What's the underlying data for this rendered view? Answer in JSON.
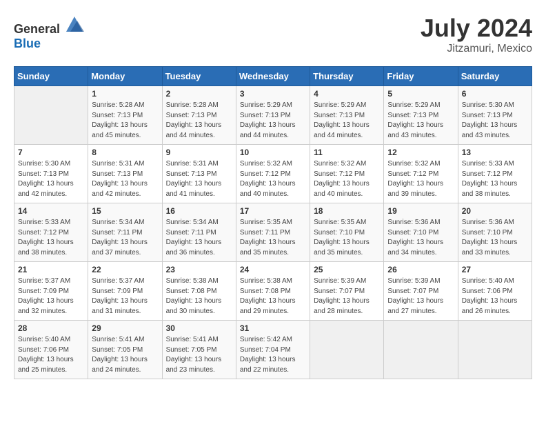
{
  "header": {
    "logo_general": "General",
    "logo_blue": "Blue",
    "month_year": "July 2024",
    "location": "Jitzamuri, Mexico"
  },
  "days_of_week": [
    "Sunday",
    "Monday",
    "Tuesday",
    "Wednesday",
    "Thursday",
    "Friday",
    "Saturday"
  ],
  "weeks": [
    [
      {
        "day": "",
        "sunrise": "",
        "sunset": "",
        "daylight": "",
        "empty": true
      },
      {
        "day": "1",
        "sunrise": "Sunrise: 5:28 AM",
        "sunset": "Sunset: 7:13 PM",
        "daylight": "Daylight: 13 hours and 45 minutes.",
        "empty": false
      },
      {
        "day": "2",
        "sunrise": "Sunrise: 5:28 AM",
        "sunset": "Sunset: 7:13 PM",
        "daylight": "Daylight: 13 hours and 44 minutes.",
        "empty": false
      },
      {
        "day": "3",
        "sunrise": "Sunrise: 5:29 AM",
        "sunset": "Sunset: 7:13 PM",
        "daylight": "Daylight: 13 hours and 44 minutes.",
        "empty": false
      },
      {
        "day": "4",
        "sunrise": "Sunrise: 5:29 AM",
        "sunset": "Sunset: 7:13 PM",
        "daylight": "Daylight: 13 hours and 44 minutes.",
        "empty": false
      },
      {
        "day": "5",
        "sunrise": "Sunrise: 5:29 AM",
        "sunset": "Sunset: 7:13 PM",
        "daylight": "Daylight: 13 hours and 43 minutes.",
        "empty": false
      },
      {
        "day": "6",
        "sunrise": "Sunrise: 5:30 AM",
        "sunset": "Sunset: 7:13 PM",
        "daylight": "Daylight: 13 hours and 43 minutes.",
        "empty": false
      }
    ],
    [
      {
        "day": "7",
        "sunrise": "Sunrise: 5:30 AM",
        "sunset": "Sunset: 7:13 PM",
        "daylight": "Daylight: 13 hours and 42 minutes.",
        "empty": false
      },
      {
        "day": "8",
        "sunrise": "Sunrise: 5:31 AM",
        "sunset": "Sunset: 7:13 PM",
        "daylight": "Daylight: 13 hours and 42 minutes.",
        "empty": false
      },
      {
        "day": "9",
        "sunrise": "Sunrise: 5:31 AM",
        "sunset": "Sunset: 7:13 PM",
        "daylight": "Daylight: 13 hours and 41 minutes.",
        "empty": false
      },
      {
        "day": "10",
        "sunrise": "Sunrise: 5:32 AM",
        "sunset": "Sunset: 7:12 PM",
        "daylight": "Daylight: 13 hours and 40 minutes.",
        "empty": false
      },
      {
        "day": "11",
        "sunrise": "Sunrise: 5:32 AM",
        "sunset": "Sunset: 7:12 PM",
        "daylight": "Daylight: 13 hours and 40 minutes.",
        "empty": false
      },
      {
        "day": "12",
        "sunrise": "Sunrise: 5:32 AM",
        "sunset": "Sunset: 7:12 PM",
        "daylight": "Daylight: 13 hours and 39 minutes.",
        "empty": false
      },
      {
        "day": "13",
        "sunrise": "Sunrise: 5:33 AM",
        "sunset": "Sunset: 7:12 PM",
        "daylight": "Daylight: 13 hours and 38 minutes.",
        "empty": false
      }
    ],
    [
      {
        "day": "14",
        "sunrise": "Sunrise: 5:33 AM",
        "sunset": "Sunset: 7:12 PM",
        "daylight": "Daylight: 13 hours and 38 minutes.",
        "empty": false
      },
      {
        "day": "15",
        "sunrise": "Sunrise: 5:34 AM",
        "sunset": "Sunset: 7:11 PM",
        "daylight": "Daylight: 13 hours and 37 minutes.",
        "empty": false
      },
      {
        "day": "16",
        "sunrise": "Sunrise: 5:34 AM",
        "sunset": "Sunset: 7:11 PM",
        "daylight": "Daylight: 13 hours and 36 minutes.",
        "empty": false
      },
      {
        "day": "17",
        "sunrise": "Sunrise: 5:35 AM",
        "sunset": "Sunset: 7:11 PM",
        "daylight": "Daylight: 13 hours and 35 minutes.",
        "empty": false
      },
      {
        "day": "18",
        "sunrise": "Sunrise: 5:35 AM",
        "sunset": "Sunset: 7:10 PM",
        "daylight": "Daylight: 13 hours and 35 minutes.",
        "empty": false
      },
      {
        "day": "19",
        "sunrise": "Sunrise: 5:36 AM",
        "sunset": "Sunset: 7:10 PM",
        "daylight": "Daylight: 13 hours and 34 minutes.",
        "empty": false
      },
      {
        "day": "20",
        "sunrise": "Sunrise: 5:36 AM",
        "sunset": "Sunset: 7:10 PM",
        "daylight": "Daylight: 13 hours and 33 minutes.",
        "empty": false
      }
    ],
    [
      {
        "day": "21",
        "sunrise": "Sunrise: 5:37 AM",
        "sunset": "Sunset: 7:09 PM",
        "daylight": "Daylight: 13 hours and 32 minutes.",
        "empty": false
      },
      {
        "day": "22",
        "sunrise": "Sunrise: 5:37 AM",
        "sunset": "Sunset: 7:09 PM",
        "daylight": "Daylight: 13 hours and 31 minutes.",
        "empty": false
      },
      {
        "day": "23",
        "sunrise": "Sunrise: 5:38 AM",
        "sunset": "Sunset: 7:08 PM",
        "daylight": "Daylight: 13 hours and 30 minutes.",
        "empty": false
      },
      {
        "day": "24",
        "sunrise": "Sunrise: 5:38 AM",
        "sunset": "Sunset: 7:08 PM",
        "daylight": "Daylight: 13 hours and 29 minutes.",
        "empty": false
      },
      {
        "day": "25",
        "sunrise": "Sunrise: 5:39 AM",
        "sunset": "Sunset: 7:07 PM",
        "daylight": "Daylight: 13 hours and 28 minutes.",
        "empty": false
      },
      {
        "day": "26",
        "sunrise": "Sunrise: 5:39 AM",
        "sunset": "Sunset: 7:07 PM",
        "daylight": "Daylight: 13 hours and 27 minutes.",
        "empty": false
      },
      {
        "day": "27",
        "sunrise": "Sunrise: 5:40 AM",
        "sunset": "Sunset: 7:06 PM",
        "daylight": "Daylight: 13 hours and 26 minutes.",
        "empty": false
      }
    ],
    [
      {
        "day": "28",
        "sunrise": "Sunrise: 5:40 AM",
        "sunset": "Sunset: 7:06 PM",
        "daylight": "Daylight: 13 hours and 25 minutes.",
        "empty": false
      },
      {
        "day": "29",
        "sunrise": "Sunrise: 5:41 AM",
        "sunset": "Sunset: 7:05 PM",
        "daylight": "Daylight: 13 hours and 24 minutes.",
        "empty": false
      },
      {
        "day": "30",
        "sunrise": "Sunrise: 5:41 AM",
        "sunset": "Sunset: 7:05 PM",
        "daylight": "Daylight: 13 hours and 23 minutes.",
        "empty": false
      },
      {
        "day": "31",
        "sunrise": "Sunrise: 5:42 AM",
        "sunset": "Sunset: 7:04 PM",
        "daylight": "Daylight: 13 hours and 22 minutes.",
        "empty": false
      },
      {
        "day": "",
        "sunrise": "",
        "sunset": "",
        "daylight": "",
        "empty": true
      },
      {
        "day": "",
        "sunrise": "",
        "sunset": "",
        "daylight": "",
        "empty": true
      },
      {
        "day": "",
        "sunrise": "",
        "sunset": "",
        "daylight": "",
        "empty": true
      }
    ]
  ]
}
